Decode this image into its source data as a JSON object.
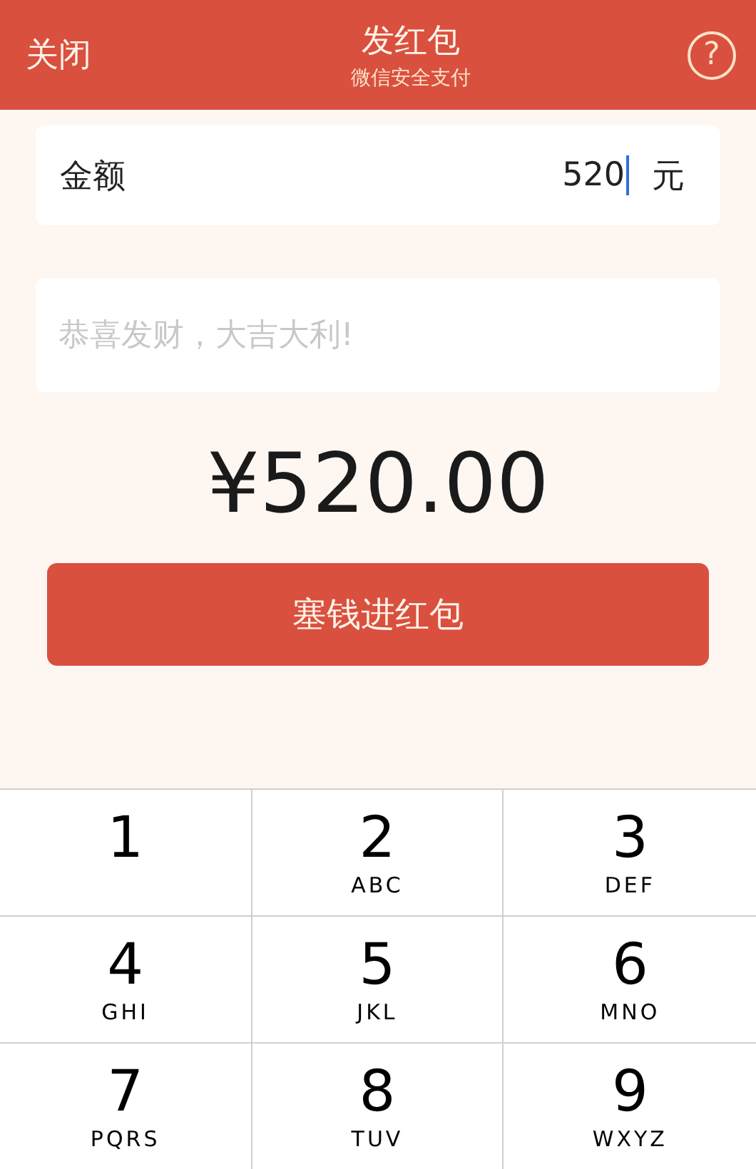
{
  "header": {
    "close": "关闭",
    "title": "发红包",
    "subtitle": "微信安全支付",
    "help": "?"
  },
  "amount_field": {
    "label": "金额",
    "value": "520",
    "unit": "元"
  },
  "message_field": {
    "placeholder": "恭喜发财，大吉大利!"
  },
  "total": "¥520.00",
  "submit_button": "塞钱进红包",
  "keypad": [
    {
      "digit": "1"
    },
    {
      "digit": "2",
      "letters": "ABC"
    },
    {
      "digit": "3",
      "letters": "DEF"
    },
    {
      "digit": "4",
      "letters": "GHI"
    },
    {
      "digit": "5",
      "letters": "JKL"
    },
    {
      "digit": "6",
      "letters": "MNO"
    },
    {
      "digit": "7",
      "letters": "PQRS"
    },
    {
      "digit": "8",
      "letters": "TUV"
    },
    {
      "digit": "9",
      "letters": "WXYZ"
    }
  ]
}
